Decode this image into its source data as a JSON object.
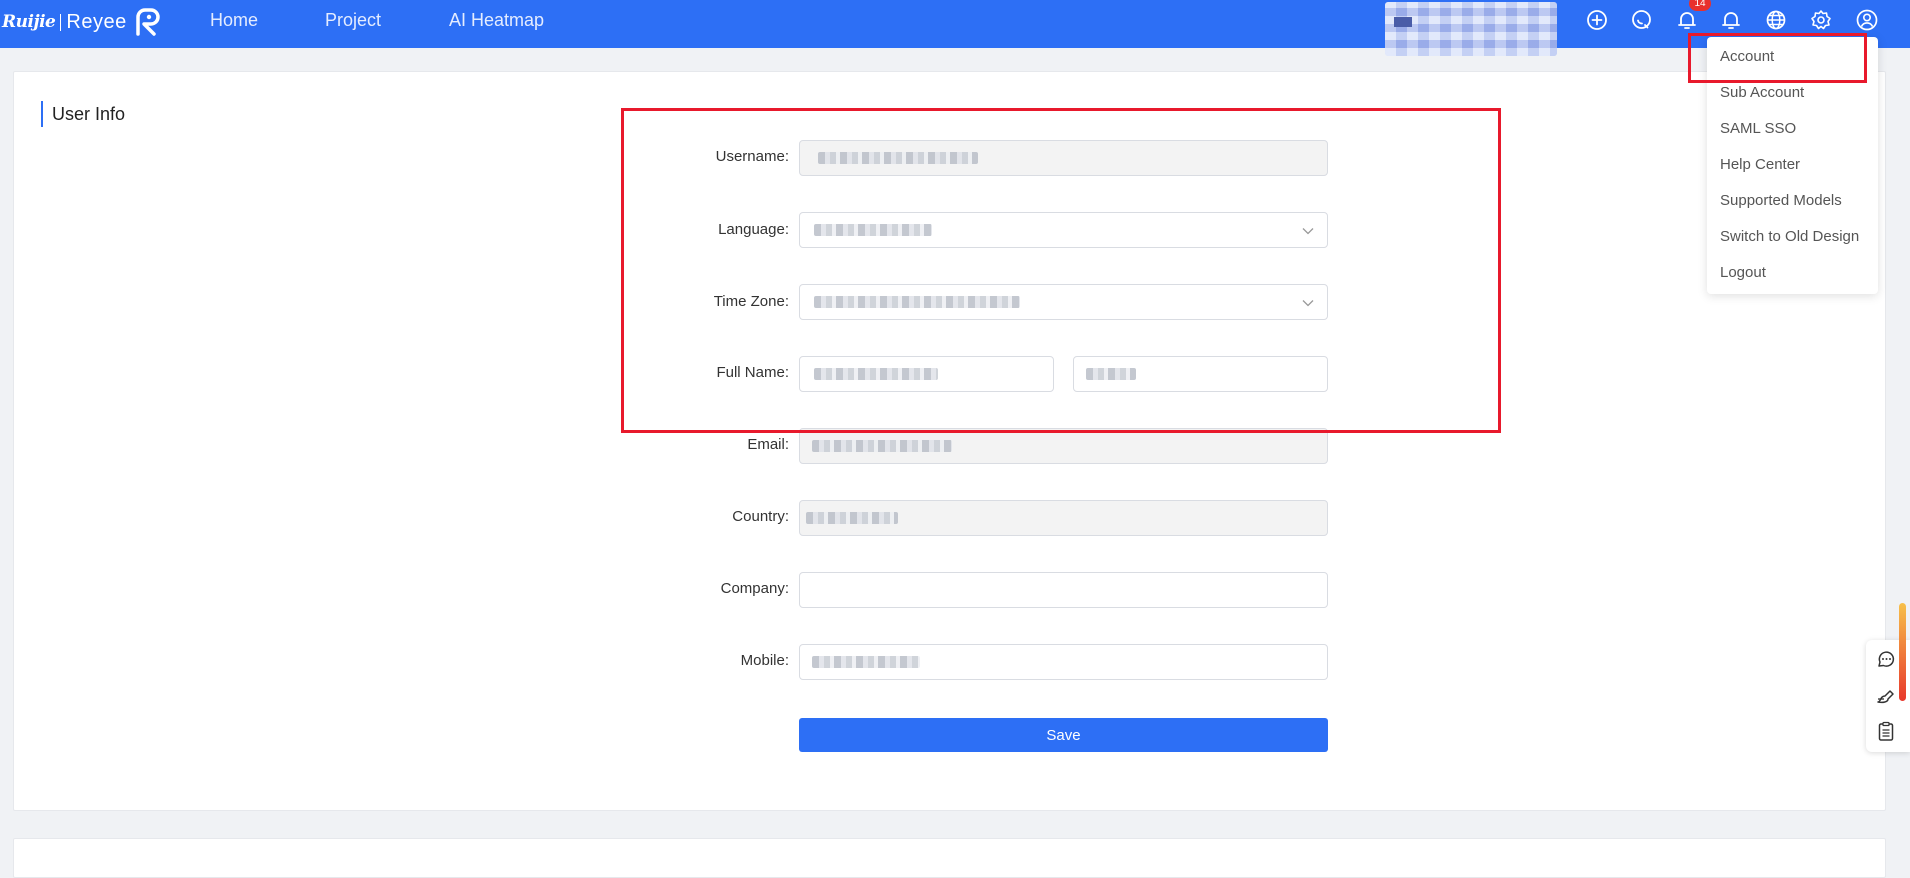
{
  "brand": {
    "name_left": "Ruijie",
    "name_right": "Reyee"
  },
  "nav": [
    {
      "label": "Home"
    },
    {
      "label": "Project"
    },
    {
      "label": "AI Heatmap"
    }
  ],
  "notifications": {
    "count": "14"
  },
  "colors": {
    "primary": "#2d6ff5",
    "highlight": "#e8192c",
    "badge": "#e8302d"
  },
  "icons": [
    "add-circle-icon",
    "search-icon",
    "bell-icon",
    "bell-icon",
    "globe-icon",
    "gear-icon",
    "user-circle-icon"
  ],
  "page": {
    "section_title": "User Info"
  },
  "form": {
    "username": {
      "label": "Username"
    },
    "language": {
      "label": "Language"
    },
    "time_zone": {
      "label": "Time Zone"
    },
    "full_name": {
      "label": "Full Name"
    },
    "email": {
      "label": "Email"
    },
    "country": {
      "label": "Country"
    },
    "company": {
      "label": "Company",
      "value": ""
    },
    "mobile": {
      "label": "Mobile"
    },
    "save_label": "Save"
  },
  "account_menu": {
    "items": [
      {
        "label": "Account"
      },
      {
        "label": "Sub Account"
      },
      {
        "label": "SAML SSO"
      },
      {
        "label": "Help Center"
      },
      {
        "label": "Supported Models"
      },
      {
        "label": "Switch to Old Design"
      },
      {
        "label": "Logout"
      }
    ]
  }
}
